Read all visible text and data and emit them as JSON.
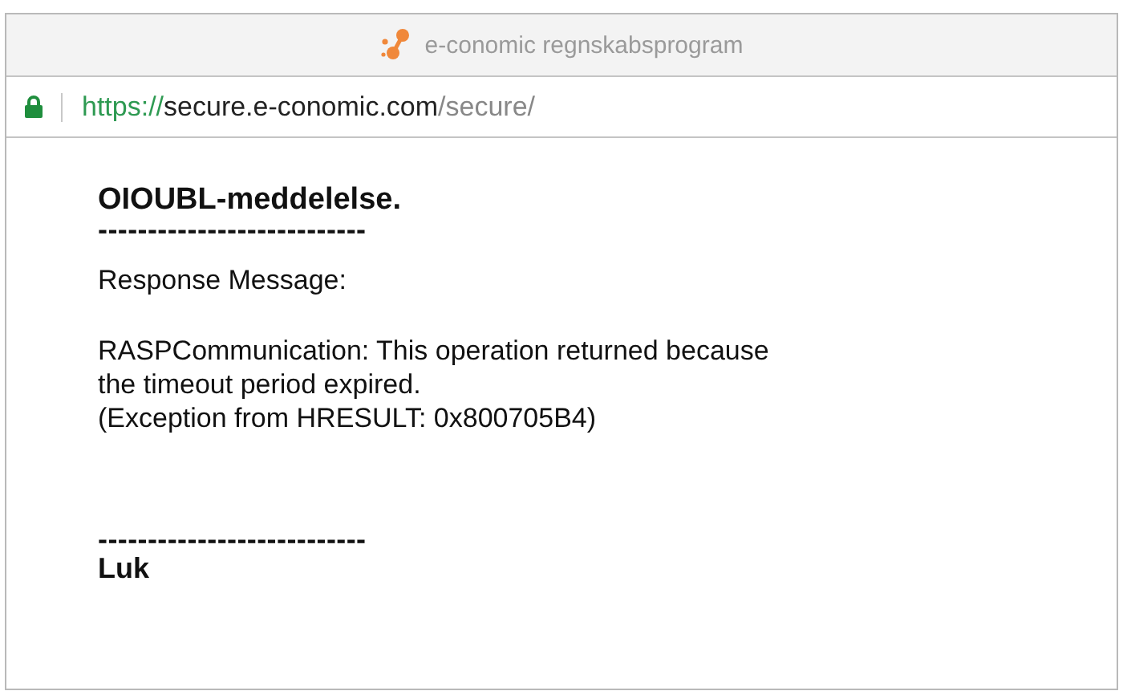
{
  "window": {
    "title": "e-conomic regnskabsprogram"
  },
  "address_bar": {
    "secure": true,
    "scheme": "https://",
    "host": "secure.e-conomic.com",
    "path": "/secure/"
  },
  "message": {
    "heading": "OIOUBL-meddelelse.",
    "separator_top": "---------------------------",
    "label": "Response Message:",
    "lines": [
      "RASPCommunication: This operation returned because",
      "the timeout period expired.",
      "(Exception from HRESULT: 0x800705B4)"
    ],
    "separator_bottom": "---------------------------",
    "close_link": "Luk"
  }
}
